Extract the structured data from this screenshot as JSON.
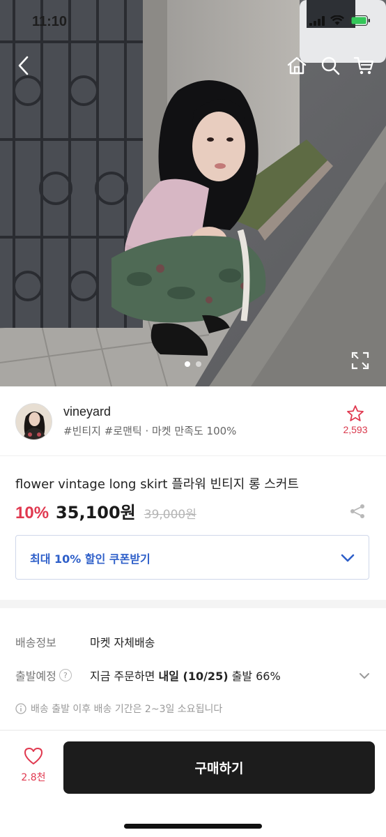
{
  "status_bar": {
    "time": "11:10"
  },
  "top_nav": {
    "icons": [
      "chevron-left-icon",
      "home-icon",
      "search-icon",
      "cart-icon"
    ]
  },
  "gallery": {
    "page_count": 2,
    "active_index": 0
  },
  "seller": {
    "name": "vineyard",
    "tags": "#빈티지 #로맨틱 · 마켓 만족도 100%",
    "follower_count": "2,593"
  },
  "product": {
    "title": "flower vintage long skirt 플라워 빈티지 롱 스커트",
    "discount_rate": "10%",
    "sale_price": "35,100원",
    "original_price": "39,000원"
  },
  "coupon": {
    "label": "최대 10% 할인 쿠폰받기"
  },
  "shipping": {
    "info_label": "배송정보",
    "info_value": "마켓 자체배송",
    "departure_label": "출발예정",
    "departure_prefix": "지금 주문하면 ",
    "departure_bold": "내일 (10/25)",
    "departure_suffix": " 출발 66%",
    "note": "배송 출발 이후 배송 기간은 2~3일 소요됩니다"
  },
  "bottom_bar": {
    "like_count": "2.8천",
    "buy_label": "구매하기"
  },
  "colors": {
    "accent_red": "#e0384f",
    "coupon_blue": "#2e5fc9",
    "buy_button_bg": "#1c1c1c"
  }
}
